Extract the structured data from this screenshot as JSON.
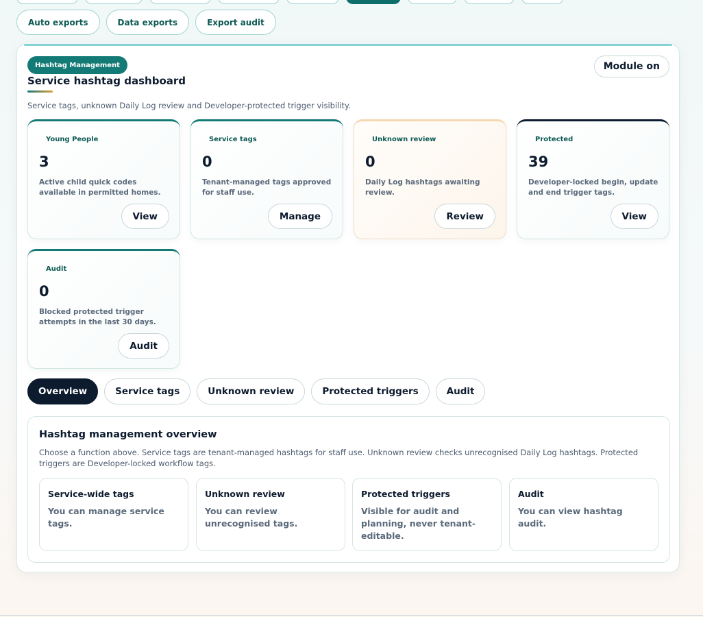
{
  "top_nav": {
    "export_buttons": [
      "Auto exports",
      "Data exports",
      "Export audit"
    ]
  },
  "panel": {
    "badge": "Hashtag Management",
    "module_status": "Module on",
    "title": "Service hashtag dashboard",
    "subtitle": "Service tags, unknown Daily Log review and Developer-protected trigger visibility."
  },
  "cards": [
    {
      "label": "Young People",
      "value": "3",
      "desc": "Active child quick codes available in permitted homes.",
      "button": "View"
    },
    {
      "label": "Service tags",
      "value": "0",
      "desc": "Tenant-managed tags approved for staff use.",
      "button": "Manage"
    },
    {
      "label": "Unknown review",
      "value": "0",
      "desc": "Daily Log hashtags awaiting review.",
      "button": "Review"
    },
    {
      "label": "Protected",
      "value": "39",
      "desc": "Developer-locked begin, update and end trigger tags.",
      "button": "View"
    },
    {
      "label": "Audit",
      "value": "0",
      "desc": "Blocked protected trigger attempts in the last 30 days.",
      "button": "Audit"
    }
  ],
  "tabs": [
    "Overview",
    "Service tags",
    "Unknown review",
    "Protected triggers",
    "Audit"
  ],
  "active_tab": "Overview",
  "overview": {
    "title": "Hashtag management overview",
    "desc": "Choose a function above. Service tags are tenant-managed hashtags for staff use. Unknown review checks unrecognised Daily Log hashtags. Protected triggers are Developer-locked workflow tags.",
    "items": [
      {
        "title": "Service-wide tags",
        "text": "You can manage service tags."
      },
      {
        "title": "Unknown review",
        "text": "You can review unrecognised tags."
      },
      {
        "title": "Protected triggers",
        "text": "Visible for audit and planning, never tenant-editable."
      },
      {
        "title": "Audit",
        "text": "You can view hashtag audit."
      }
    ]
  },
  "colors": {
    "brand_teal": "#137a75",
    "navy": "#0d1b2e",
    "warn_border": "#f5d8b0"
  }
}
